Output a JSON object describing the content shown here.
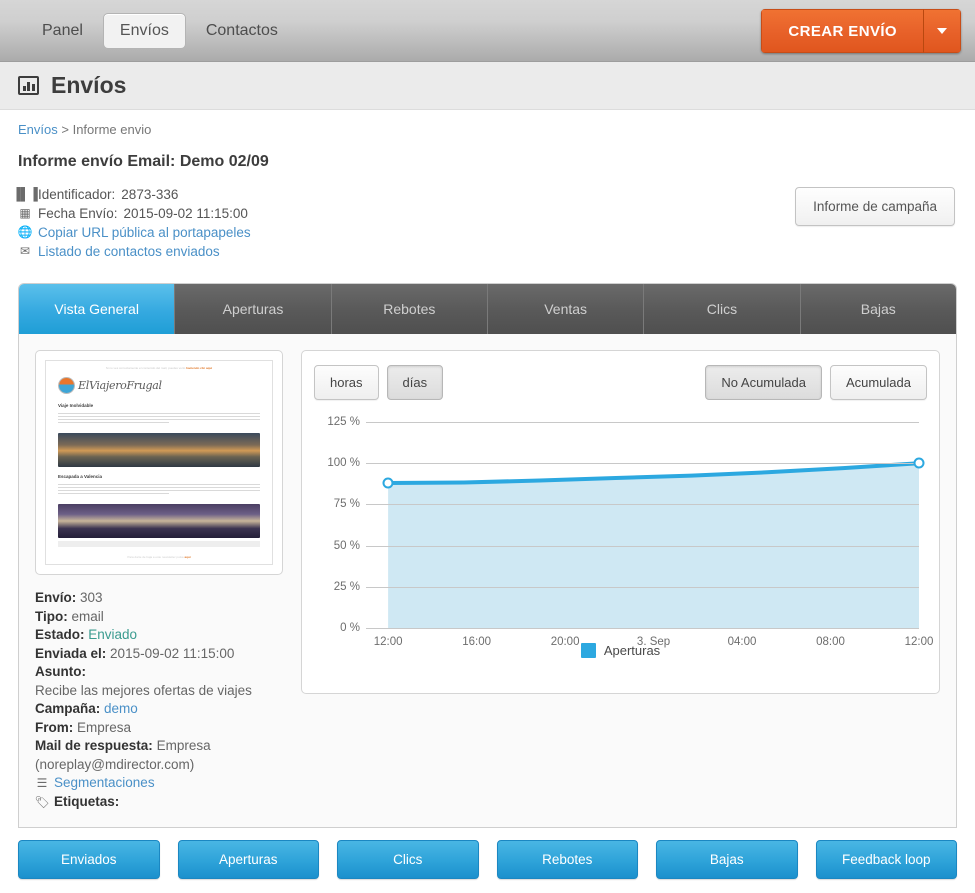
{
  "topnav": {
    "items": [
      {
        "label": "Panel",
        "active": false
      },
      {
        "label": "Envíos",
        "active": true
      },
      {
        "label": "Contactos",
        "active": false
      }
    ],
    "create_button": "CREAR ENVÍO",
    "create_caret_icon": "chevron-down-icon"
  },
  "page": {
    "icon": "bar-chart-icon",
    "title": "Envíos"
  },
  "breadcrumb": {
    "link": "Envíos",
    "separator": " > ",
    "current": "Informe envio"
  },
  "report": {
    "title": "Informe envío Email: Demo 02/09",
    "meta": [
      {
        "icon": "barcode-icon",
        "label": "Identificador:",
        "value": "2873-336",
        "link": false
      },
      {
        "icon": "calendar-icon",
        "label": "Fecha Envío:",
        "value": "2015-09-02 11:15:00",
        "link": false
      },
      {
        "icon": "globe-icon",
        "label": "Copiar URL pública al portapapeles",
        "value": "",
        "link": true
      },
      {
        "icon": "envelope-icon",
        "label": "Listado de contactos enviados",
        "value": "",
        "link": true
      }
    ],
    "campaign_report_button": "Informe de campaña"
  },
  "tabs": [
    {
      "label": "Vista General",
      "active": true
    },
    {
      "label": "Aperturas",
      "active": false
    },
    {
      "label": "Rebotes",
      "active": false
    },
    {
      "label": "Ventas",
      "active": false
    },
    {
      "label": "Clics",
      "active": false
    },
    {
      "label": "Bajas",
      "active": false
    }
  ],
  "preview": {
    "header_note": "Newsletter",
    "header_sub": "Si no ves correctamente el contenido del mail, puedes verlo",
    "header_link": "haciendo clic aquí",
    "brand": "ElViajeroFrugal",
    "section1_title": "Viaje Inolvidable",
    "section2_title": "Escapada a Valencia",
    "footer": "Para darte de baja a este newsletter pulsa",
    "footer_link": "aquí"
  },
  "details": {
    "envio_label": "Envío:",
    "envio_value": "303",
    "tipo_label": "Tipo:",
    "tipo_value": "email",
    "estado_label": "Estado:",
    "estado_value": "Enviado",
    "enviada_label": "Enviada el:",
    "enviada_value": "2015-09-02 11:15:00",
    "asunto_label": "Asunto:",
    "asunto_value": "Recibe las mejores ofertas de viajes",
    "campana_label": "Campaña:",
    "campana_value": "demo",
    "from_label": "From:",
    "from_value": "Empresa",
    "reply_label": "Mail de respuesta:",
    "reply_value": "Empresa (noreplay@mdirector.com)",
    "segmentaciones_link": "Segmentaciones",
    "etiquetas_label": "Etiquetas:"
  },
  "chart_toolbar": {
    "left": [
      {
        "label": "horas",
        "selected": false
      },
      {
        "label": "días",
        "selected": true
      }
    ],
    "right": [
      {
        "label": "No Acumulada",
        "selected": true
      },
      {
        "label": "Acumulada",
        "selected": false
      }
    ]
  },
  "chart_data": {
    "type": "area",
    "title": "",
    "xlabel": "",
    "ylabel": "",
    "ylim": [
      0,
      125
    ],
    "yticks": [
      "0 %",
      "25 %",
      "50 %",
      "75 %",
      "100 %",
      "125 %"
    ],
    "ytick_values": [
      0,
      25,
      50,
      75,
      100,
      125
    ],
    "xticks": [
      "12:00",
      "16:00",
      "20:00",
      "3. Sep",
      "04:00",
      "08:00",
      "12:00"
    ],
    "grid": true,
    "legend_position": "bottom",
    "series": [
      {
        "name": "Aperturas",
        "color": "#2ca8e0",
        "fill_color": "#cfe8f3",
        "x": [
          "11:00",
          "12:00",
          "16:00",
          "20:00",
          "3. Sep",
          "04:00",
          "08:00",
          "12:00"
        ],
        "values": [
          88,
          88.3,
          89.5,
          91,
          92.5,
          94.5,
          97,
          100
        ]
      }
    ]
  },
  "bottom_buttons": [
    {
      "label": "Enviados"
    },
    {
      "label": "Aperturas"
    },
    {
      "label": "Clics"
    },
    {
      "label": "Rebotes"
    },
    {
      "label": "Bajas"
    },
    {
      "label": "Feedback loop"
    }
  ]
}
